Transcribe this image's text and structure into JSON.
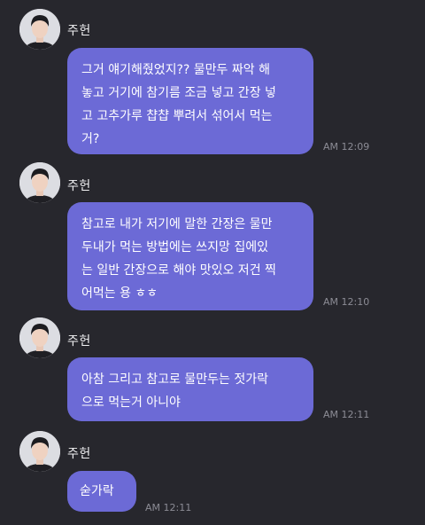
{
  "colors": {
    "background": "#27272d",
    "bubble": "#6c6ad6",
    "timestamp": "#8c8c95"
  },
  "messages": [
    {
      "sender": "주헌",
      "text": "그거 얘기해줬었지?? 물만두 짜악 해\n놓고 거기에 참기름 조금 넣고 간장 넣\n고 고추가루 챱챱 뿌려서 섞어서 먹는\n거?",
      "time": "AM 12:09",
      "avatar_icon": "profile-photo"
    },
    {
      "sender": "주헌",
      "text": "참고로 내가 저기에 말한 간장은 물만\n두내가 먹는 방법에는 쓰지망 집에있\n는 일반 간장으로 해야 맛있오 저건 찍\n어먹는 용 ㅎㅎ",
      "time": "AM 12:10",
      "avatar_icon": "profile-photo"
    },
    {
      "sender": "주헌",
      "text": "아참 그리고 참고로 물만두는 젓가락\n으로 먹는거 아니야",
      "time": "AM 12:11",
      "avatar_icon": "profile-photo"
    },
    {
      "sender": "주헌",
      "text": "숟가락",
      "time": "AM 12:11",
      "avatar_icon": "profile-photo"
    }
  ]
}
